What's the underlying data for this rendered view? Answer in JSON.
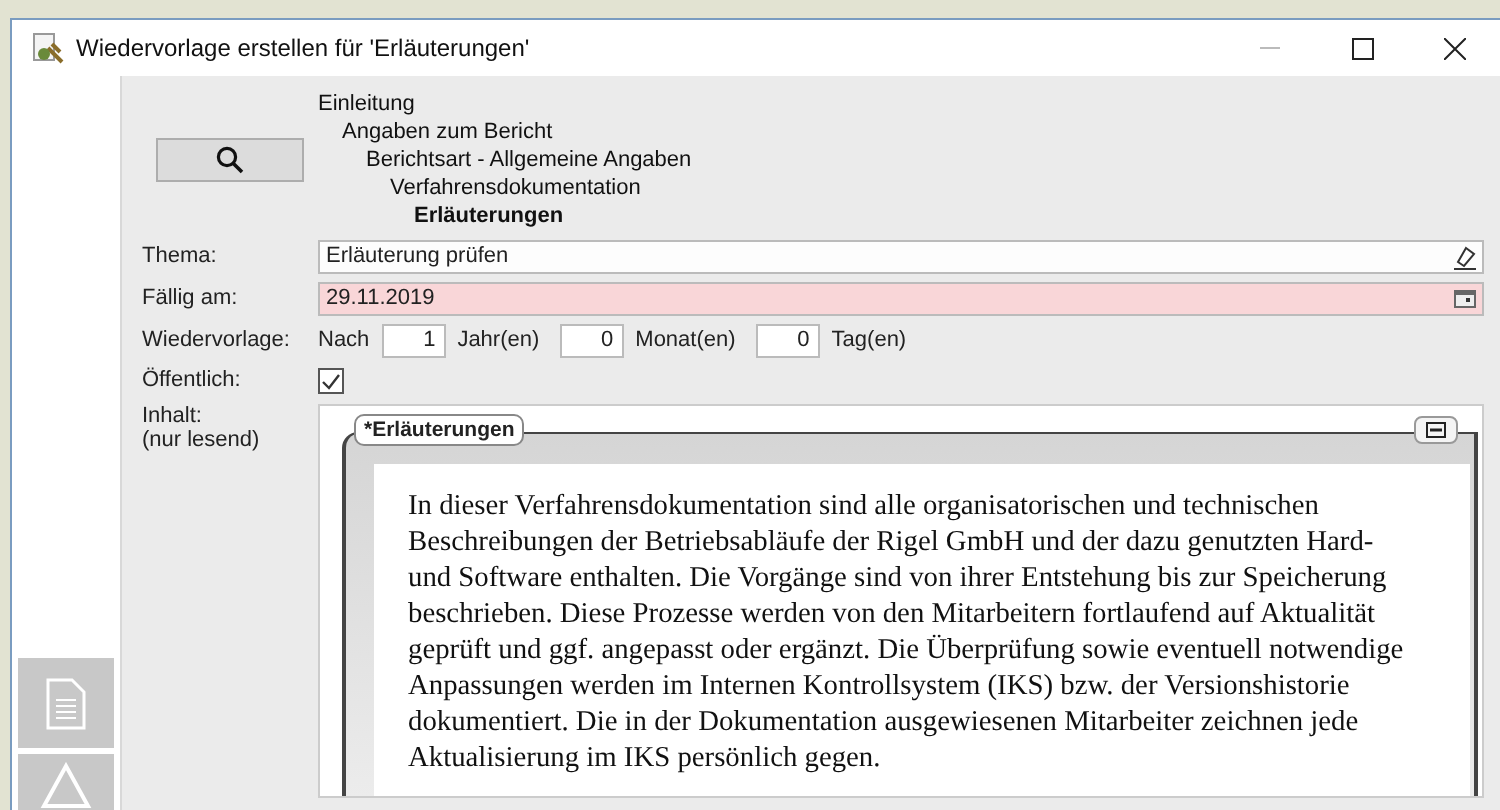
{
  "window": {
    "title": "Wiedervorlage erstellen für 'Erläuterungen'"
  },
  "tree": [
    {
      "label": "Einleitung",
      "selected": false,
      "children": [
        {
          "label": "Angaben zum Bericht",
          "selected": false,
          "children": [
            {
              "label": "Berichtsart - Allgemeine Angaben",
              "selected": false,
              "children": [
                {
                  "label": "Verfahrensdokumentation",
                  "selected": false,
                  "children": [
                    {
                      "label": "Erläuterungen",
                      "selected": true
                    }
                  ]
                }
              ]
            }
          ]
        }
      ]
    }
  ],
  "form": {
    "thema": {
      "label": "Thema:",
      "value": "Erläuterung prüfen"
    },
    "faellig": {
      "label": "Fällig am:",
      "value": "29.11.2019",
      "invalid": true
    },
    "wiedervorlage": {
      "label": "Wiedervorlage:",
      "prefix": "Nach",
      "parts": [
        {
          "value": "1",
          "unit": "Jahr(en)"
        },
        {
          "value": "0",
          "unit": "Monat(en)"
        },
        {
          "value": "0",
          "unit": "Tag(en)"
        }
      ]
    },
    "oeffentlich": {
      "label": "Öffentlich:",
      "checked": true
    },
    "inhalt": {
      "label": "Inhalt:",
      "sublabel": "(nur lesend)",
      "group_title": "*Erläuterungen",
      "text": "In dieser Verfahrensdokumentation sind alle organisatorischen und technischen Beschreibungen der Betriebsabläufe der Rigel GmbH und der dazu genutzten Hard- und Software enthalten. Die Vorgänge sind von ihrer Entstehung bis zur Speicherung beschrieben. Diese Prozesse werden von den Mitarbeitern fortlaufend auf Aktualität geprüft und ggf. angepasst oder ergänzt. Die Überprüfung sowie eventuell notwendige Anpassungen werden im Internen Kontrollsystem (IKS) bzw. der Versionshistorie dokumentiert. Die in der Dokumentation ausgewiesenen Mitarbeiter zeichnen jede Aktualisierung im IKS persönlich gegen."
    }
  }
}
